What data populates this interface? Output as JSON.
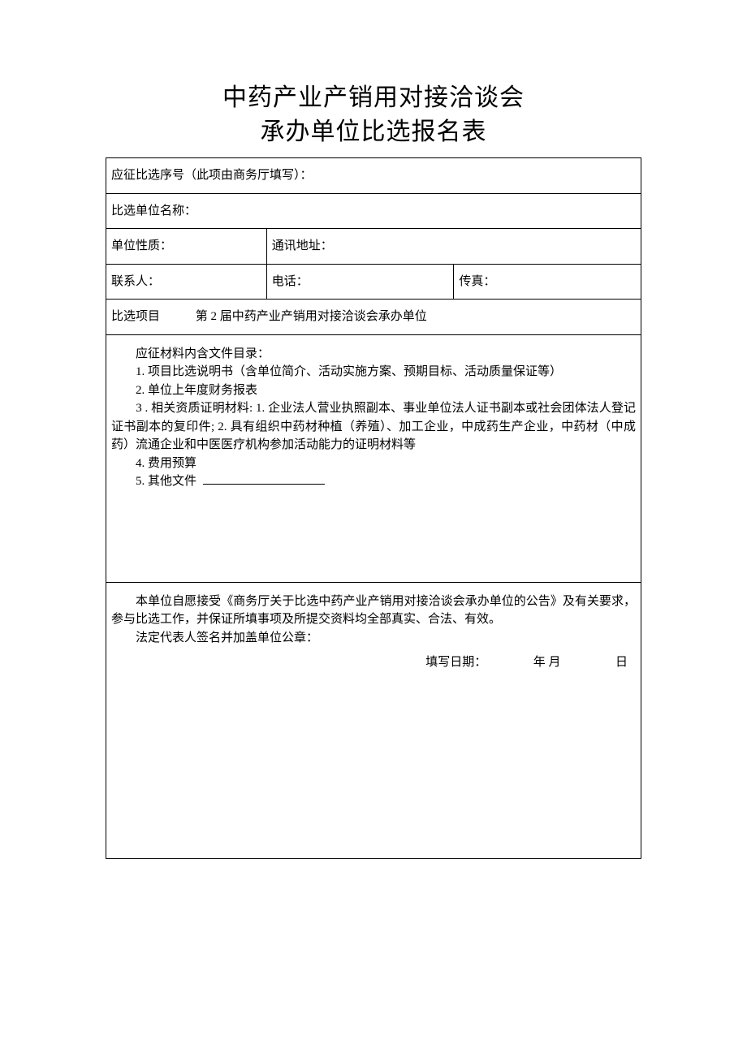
{
  "title": {
    "line1": "中药产业产销用对接洽谈会",
    "line2": "承办单位比选报名表"
  },
  "rows": {
    "seq_label": "应征比选序号（此项由商务厅填写）：",
    "unit_name_label": "比选单位名称：",
    "unit_type_label": "单位性质：",
    "address_label": "通讯地址：",
    "contact_label": "联系人：",
    "phone_label": "电话：",
    "fax_label": "传真：",
    "project_label": "比选项目",
    "project_value": "第 2 届中药产业产销用对接洽谈会承办单位"
  },
  "materials": {
    "heading": "应征材料内含文件目录：",
    "item1": "1. 项目比选说明书（含单位简介、活动实施方案、预期目标、活动质量保证等）",
    "item2": "2. 单位上年度财务报表",
    "item3": "3 . 相关资质证明材料: 1. 企业法人营业执照副本、事业单位法人证书副本或社会团体法人登记证书副本的复印件; 2. 具有组织中药材种植（养殖）、加工企业，中成药生产企业，中药材（中成药）流通企业和中医医疗机构参加活动能力的证明材料等",
    "item4": "4. 费用预算",
    "item5": "5. 其他文件"
  },
  "declaration": {
    "line1": "本单位自愿接受《商务厅关于比选中药产业产销用对接洽谈会承办单位的公告》及有关要求，参与比选工作，并保证所填事项及所提交资料均全部真实、合法、有效。",
    "signature_label": "法定代表人签名并加盖单位公章：",
    "date_label": "填写日期：",
    "year_month": "年 月",
    "day": "日"
  }
}
